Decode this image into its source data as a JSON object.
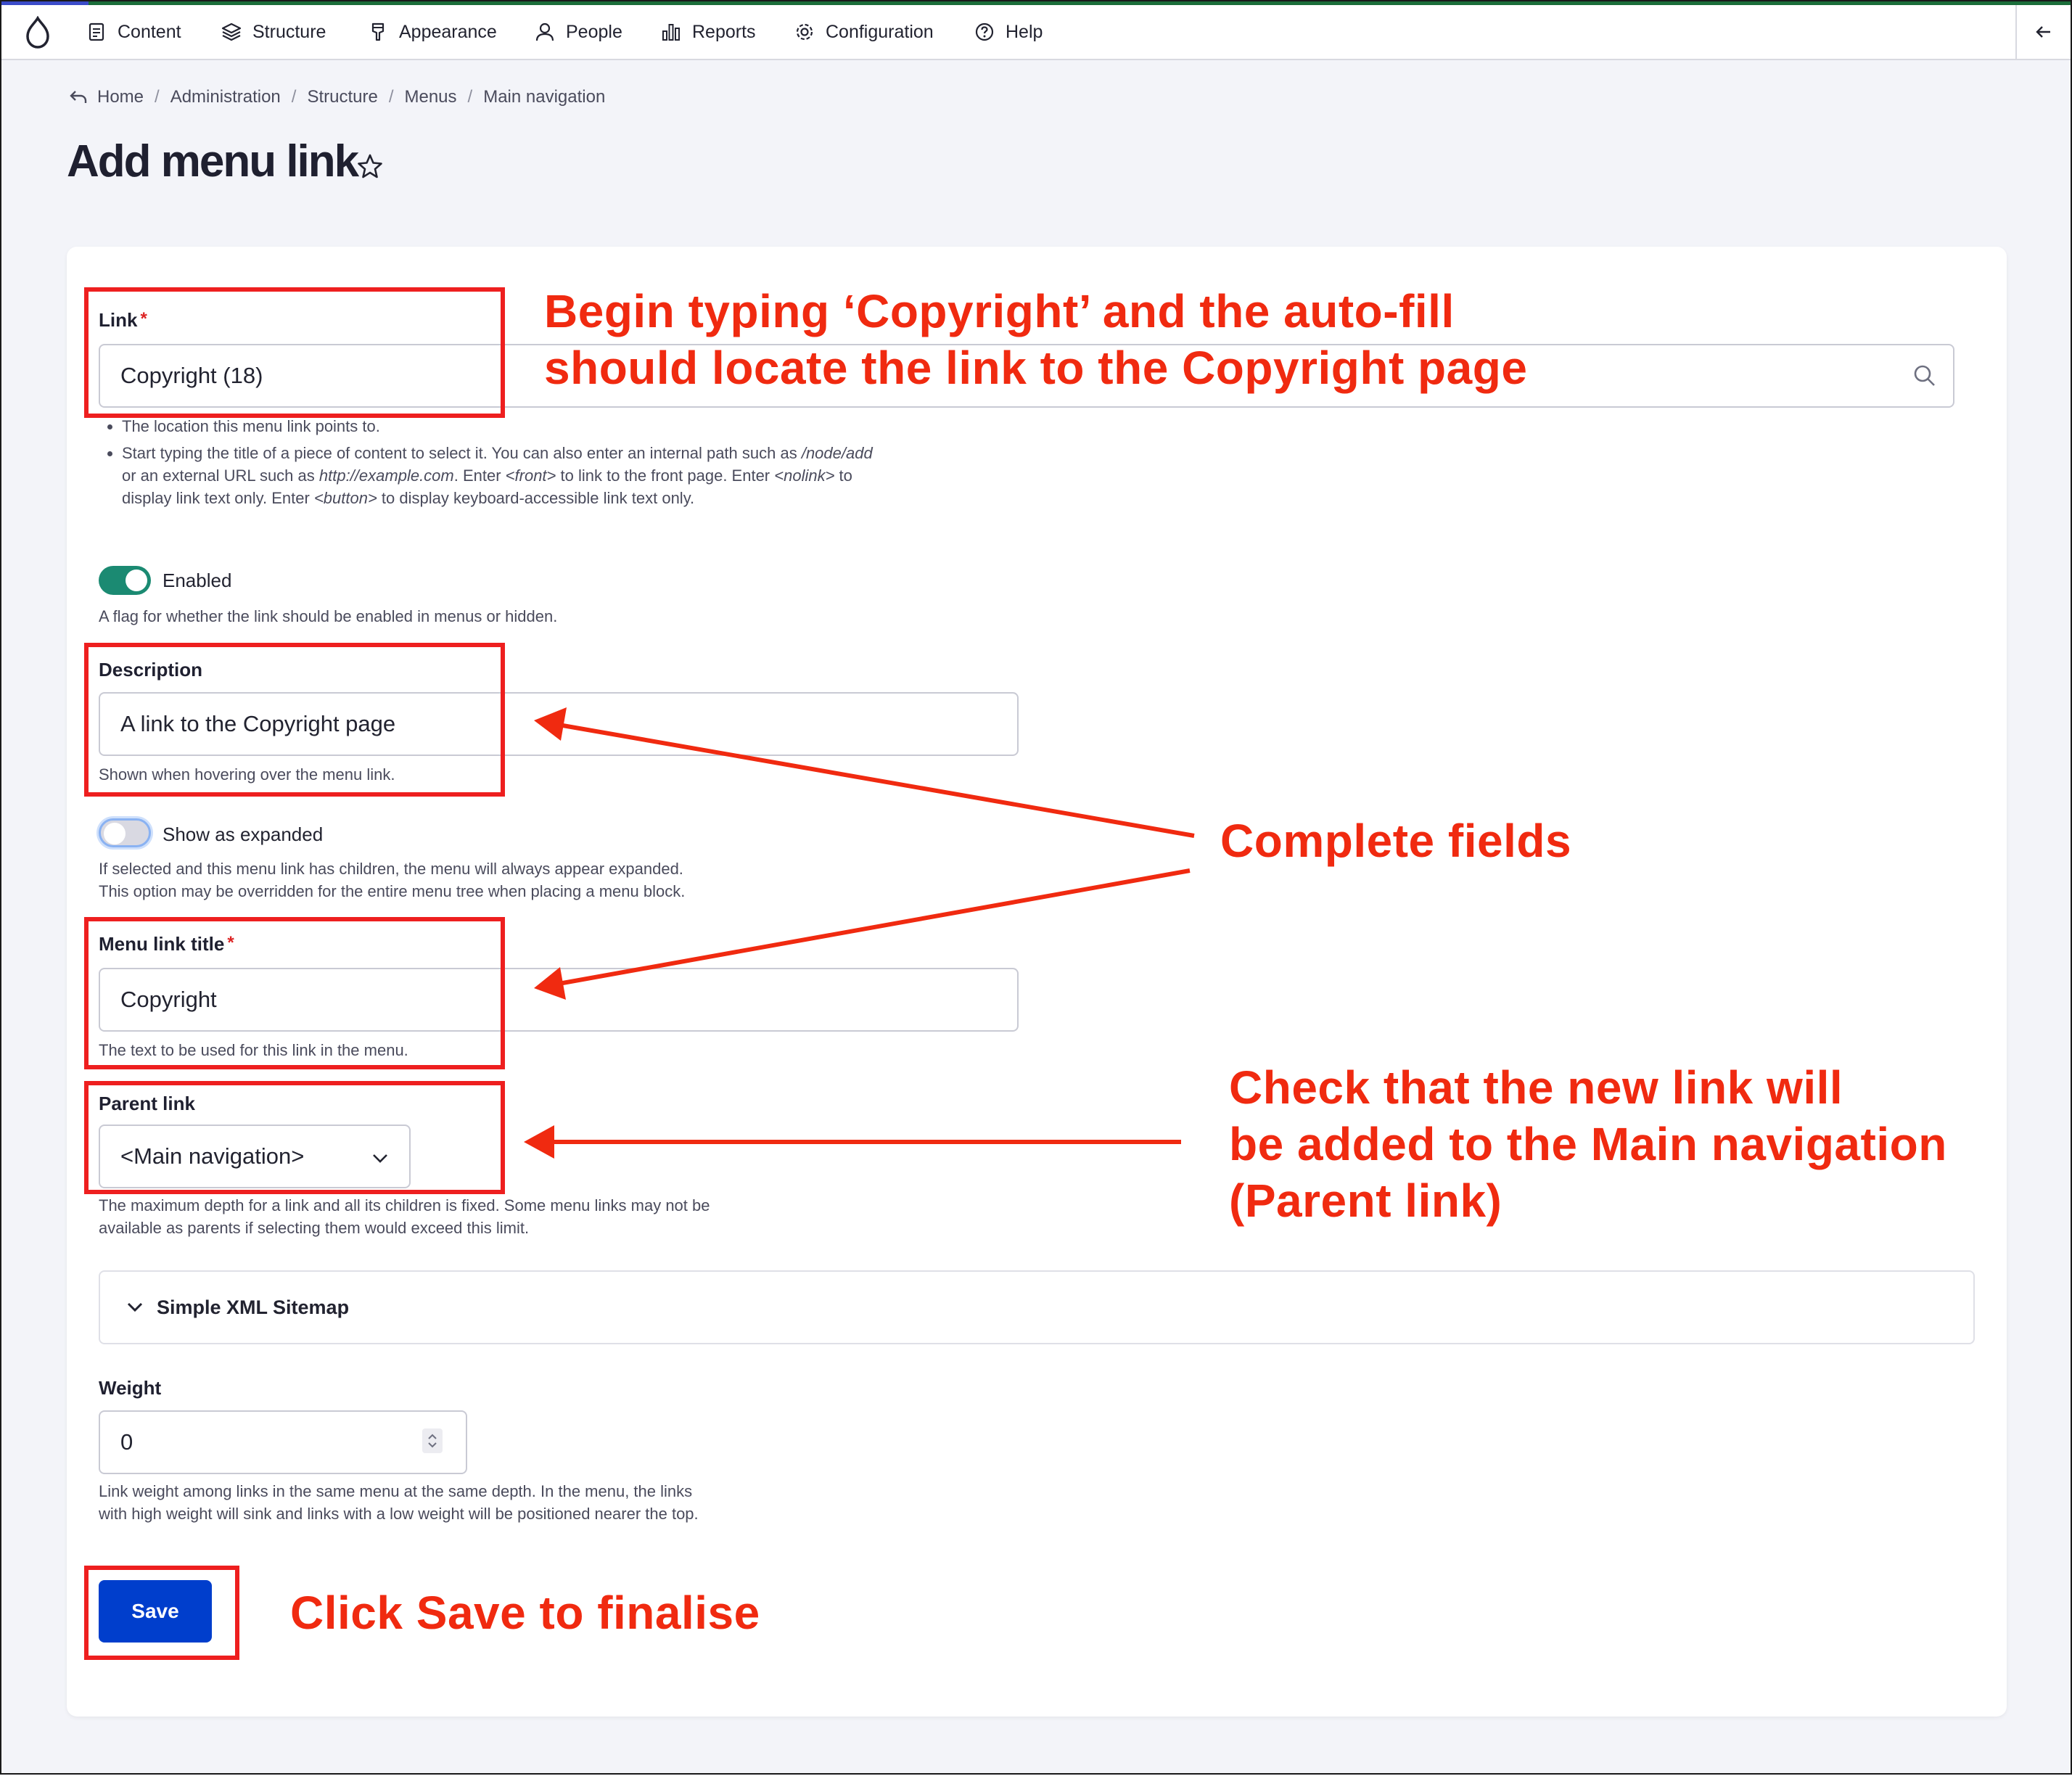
{
  "toolbar": {
    "items": [
      {
        "label": "Content",
        "icon": "content-icon"
      },
      {
        "label": "Structure",
        "icon": "structure-icon"
      },
      {
        "label": "Appearance",
        "icon": "appearance-icon"
      },
      {
        "label": "People",
        "icon": "people-icon"
      },
      {
        "label": "Reports",
        "icon": "reports-icon"
      },
      {
        "label": "Configuration",
        "icon": "configuration-icon"
      },
      {
        "label": "Help",
        "icon": "help-icon"
      }
    ]
  },
  "breadcrumb": [
    "Home",
    "Administration",
    "Structure",
    "Menus",
    "Main navigation"
  ],
  "page": {
    "title": "Add menu link"
  },
  "form": {
    "link": {
      "label": "Link",
      "required": "*",
      "value": "Copyright (18)",
      "help_1": "The location this menu link points to.",
      "help_2_a": "Start typing the title of a piece of content to select it. You can also enter an internal path such as ",
      "help_2_b": "/node/add",
      "help_2_c": " or an external URL such as ",
      "help_2_d": "http://example.com",
      "help_2_e": ". Enter ",
      "help_2_f": "<front>",
      "help_2_g": " to link to the front page. Enter ",
      "help_2_h": "<nolink>",
      "help_2_i": " to display link text only. Enter ",
      "help_2_j": "<button>",
      "help_2_k": " to display keyboard-accessible link text only."
    },
    "enabled": {
      "label": "Enabled",
      "checked": true,
      "help": "A flag for whether the link should be enabled in menus or hidden."
    },
    "description": {
      "label": "Description",
      "value": "A link to the Copyright page",
      "help": "Shown when hovering over the menu link."
    },
    "expanded": {
      "label": "Show as expanded",
      "checked": false,
      "help_1": "If selected and this menu link has children, the menu will always appear expanded.",
      "help_2": "This option may be overridden for the entire menu tree when placing a menu block."
    },
    "menu_title": {
      "label": "Menu link title",
      "required": "*",
      "value": "Copyright",
      "help": "The text to be used for this link in the menu."
    },
    "parent": {
      "label": "Parent link",
      "selected": "<Main navigation>",
      "help_1": "The maximum depth for a link and all its children is fixed. Some menu links may not be",
      "help_2": "available as parents if selecting them would exceed this limit."
    },
    "sitemap": {
      "label": "Simple XML Sitemap"
    },
    "weight": {
      "label": "Weight",
      "value": "0",
      "help_1": "Link weight among links in the same menu at the same depth. In the menu, the links",
      "help_2": "with high weight will sink and links with a low weight will be positioned nearer the top."
    },
    "save_label": "Save"
  },
  "annotations": {
    "link_note_1": "Begin typing ‘Copyright’ and the auto-fill",
    "link_note_2": "should locate the link to the Copyright page",
    "fields_note": "Complete fields",
    "parent_note_1": "Check that the new link will",
    "parent_note_2": "be added to the Main navigation",
    "parent_note_3": "(Parent link)",
    "save_note": "Click Save to finalise",
    "color": "#f02a10"
  },
  "colors": {
    "accent": "#003ecc",
    "toggle_on": "#1b8a72",
    "required": "#dc2323",
    "background": "#f3f4f9"
  }
}
